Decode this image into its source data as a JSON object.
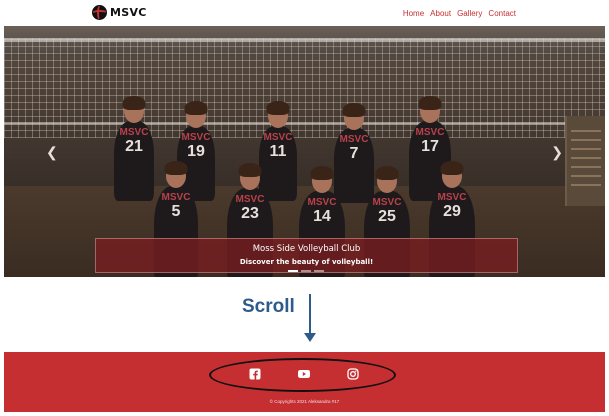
{
  "brand": {
    "name": "MSVC"
  },
  "nav": {
    "links": [
      "Home",
      "About",
      "Gallery",
      "Contact"
    ]
  },
  "hero": {
    "caption_title": "Moss Side Volleyball Club",
    "caption_subtitle": "Discover the beauty of volleyball!",
    "slide_count": 3,
    "active_slide": 1,
    "players": [
      {
        "label": "MSVC",
        "number": "21"
      },
      {
        "label": "MSVC",
        "number": "19"
      },
      {
        "label": "MSVC",
        "number": "11"
      },
      {
        "label": "MSVC",
        "number": "7"
      },
      {
        "label": "MSVC",
        "number": "17"
      },
      {
        "label": "MSVC",
        "number": "5"
      },
      {
        "label": "MSVC",
        "number": "23"
      },
      {
        "label": "MSVC",
        "number": "14"
      },
      {
        "label": "MSVC",
        "number": "25"
      },
      {
        "label": "MSVC",
        "number": "29"
      }
    ]
  },
  "annotation": {
    "scroll_label": "Scroll"
  },
  "footer": {
    "social": [
      "facebook-icon",
      "youtube-icon",
      "instagram-icon"
    ],
    "copyright": "© Copyrights 2021 Aleksandra #17"
  },
  "colors": {
    "brand_red": "#c62f31",
    "annotation_blue": "#2e5a8c"
  }
}
